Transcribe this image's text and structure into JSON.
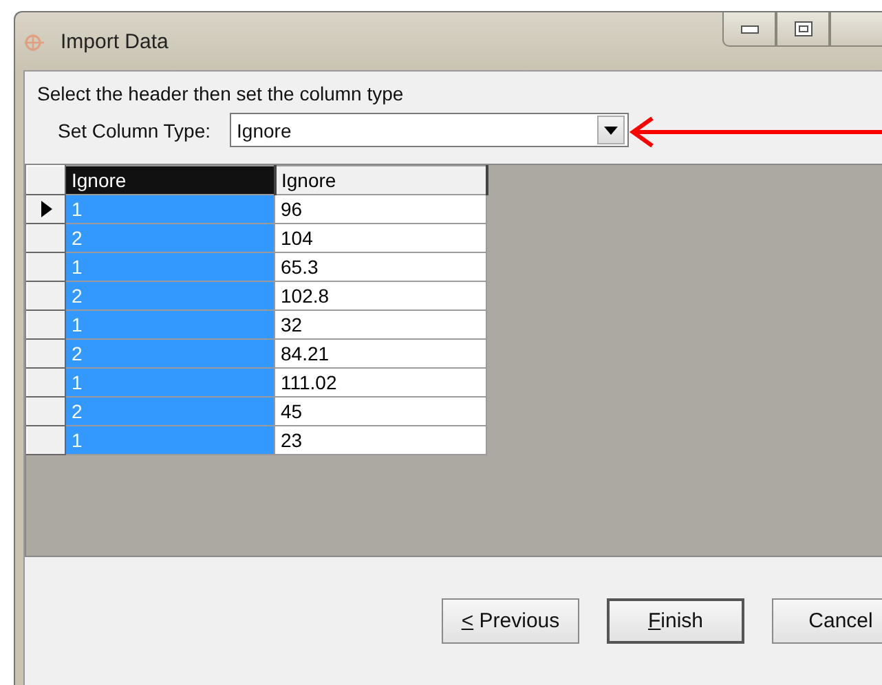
{
  "window": {
    "title": "Import Data"
  },
  "instruction": "Select the header then set the column type",
  "column_type": {
    "label": "Set Column Type:",
    "value": "Ignore"
  },
  "annotation": {
    "kind": "arrow"
  },
  "grid": {
    "columns": [
      {
        "label": "Ignore",
        "selected": true
      },
      {
        "label": "Ignore",
        "selected": false
      }
    ],
    "rows": [
      {
        "current": true,
        "cells": [
          "1",
          "96"
        ]
      },
      {
        "current": false,
        "cells": [
          "2",
          "104"
        ]
      },
      {
        "current": false,
        "cells": [
          "1",
          "65.3"
        ]
      },
      {
        "current": false,
        "cells": [
          "2",
          "102.8"
        ]
      },
      {
        "current": false,
        "cells": [
          "1",
          "32"
        ]
      },
      {
        "current": false,
        "cells": [
          "2",
          "84.21"
        ]
      },
      {
        "current": false,
        "cells": [
          "1",
          "111.02"
        ]
      },
      {
        "current": false,
        "cells": [
          "2",
          "45"
        ]
      },
      {
        "current": false,
        "cells": [
          "1",
          "23"
        ]
      }
    ]
  },
  "buttons": [
    {
      "label": "< Previous",
      "default": false,
      "mnemonic_first": true
    },
    {
      "label": "Finish",
      "default": true,
      "mnemonic_first": true
    },
    {
      "label": "Cancel",
      "default": false,
      "mnemonic_first": false
    }
  ]
}
